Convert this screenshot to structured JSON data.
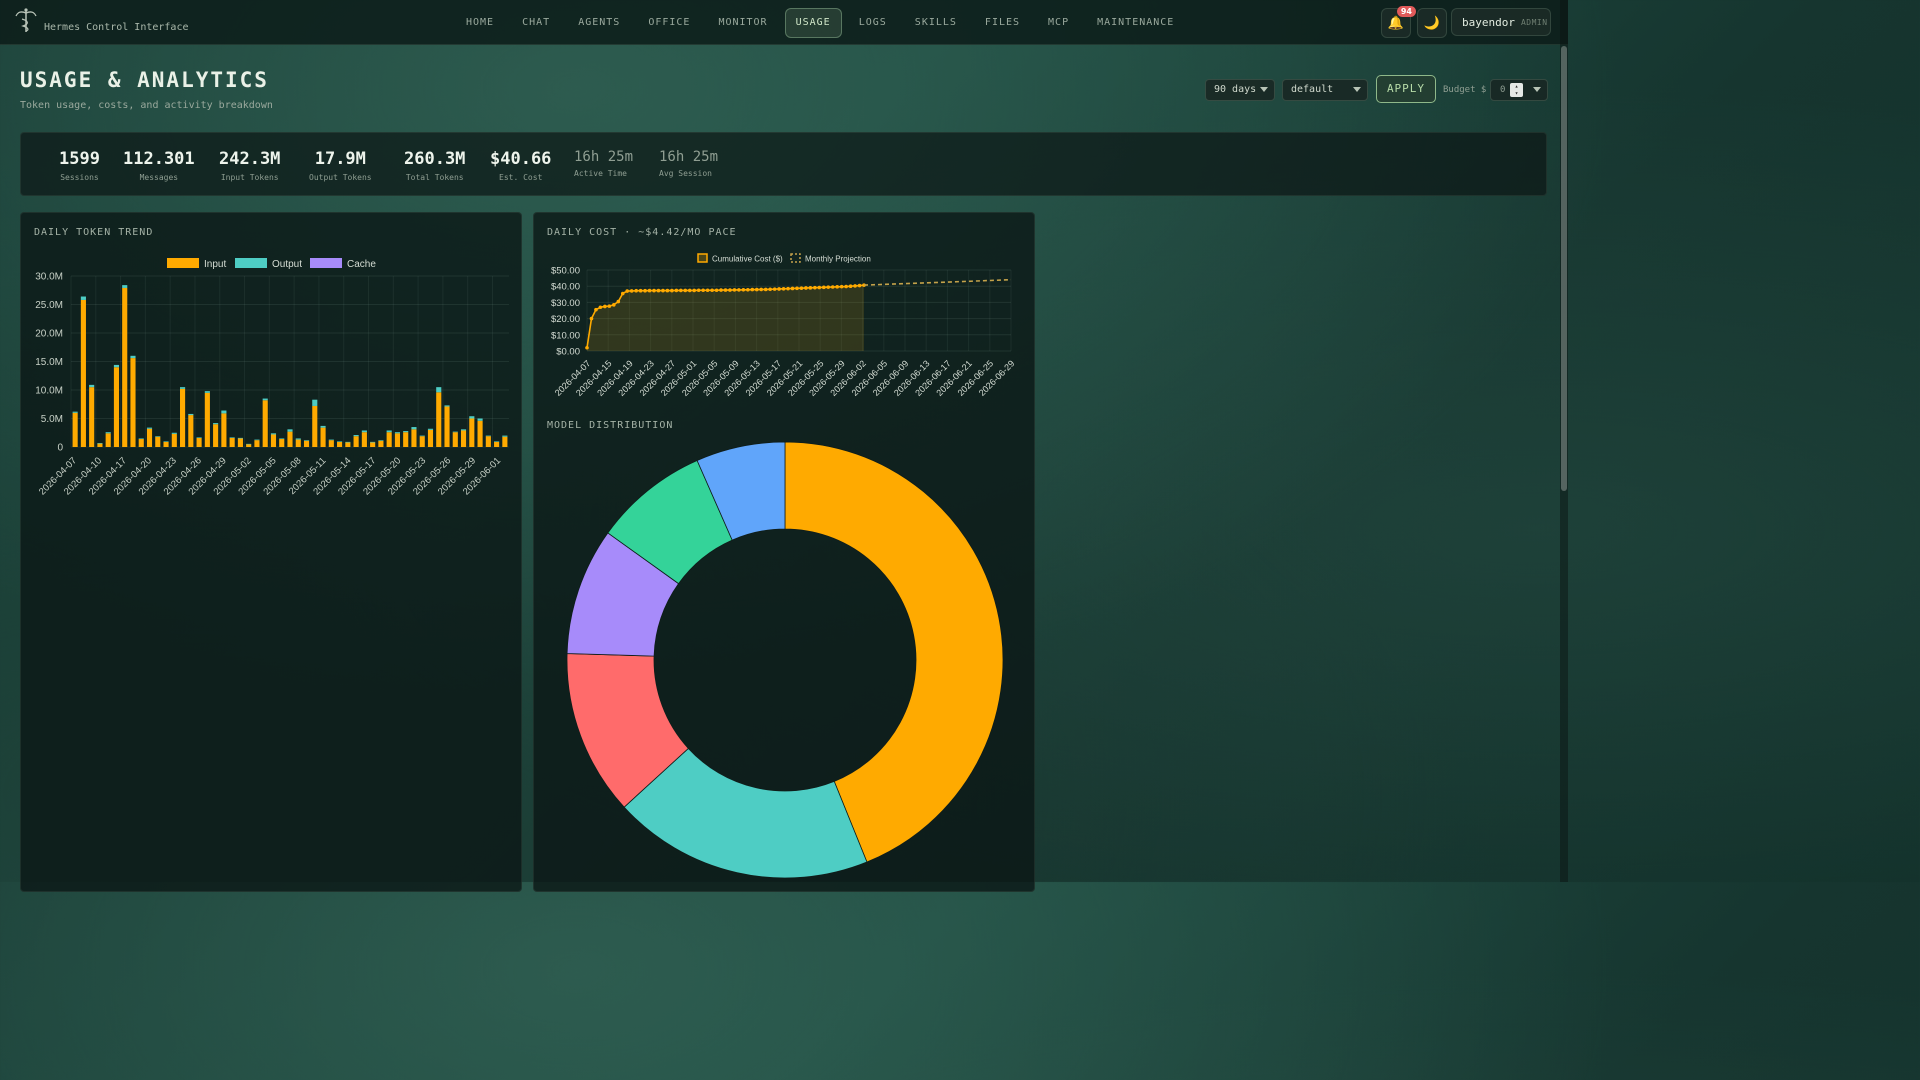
{
  "app": {
    "title": "Hermes Control Interface"
  },
  "nav": {
    "items": [
      "HOME",
      "CHAT",
      "AGENTS",
      "OFFICE",
      "MONITOR",
      "USAGE",
      "LOGS",
      "SKILLS",
      "FILES",
      "MCP",
      "MAINTENANCE"
    ],
    "active": "USAGE"
  },
  "notifications": {
    "count": "94"
  },
  "user": {
    "name": "bayendor",
    "role": "ADMIN"
  },
  "header": {
    "title": "USAGE & ANALYTICS",
    "subtitle": "Token usage, costs, and activity breakdown"
  },
  "controls": {
    "range": "90 days",
    "profile": "default",
    "apply_label": "APPLY",
    "budget_label": "Budget $",
    "budget_value": "0"
  },
  "stats": [
    {
      "value": "1599",
      "label": "Sessions"
    },
    {
      "value": "112.301",
      "label": "Messages"
    },
    {
      "value": "242.3M",
      "label": "Input Tokens"
    },
    {
      "value": "17.9M",
      "label": "Output Tokens"
    },
    {
      "value": "260.3M",
      "label": "Total Tokens"
    },
    {
      "value": "$40.66",
      "label": "Est. Cost"
    },
    {
      "value": "16h 25m",
      "label": "Active Time"
    },
    {
      "value": "16h 25m",
      "label": "Avg Session"
    }
  ],
  "panels": {
    "token_trend_title": "DAILY TOKEN TREND",
    "daily_cost_title": "DAILY COST · ~$4.42/MO PACE",
    "model_distribution_title": "MODEL DISTRIBUTION"
  },
  "colors": {
    "input": "#ffaa00",
    "output": "#4ecdc4",
    "cache": "#a78bfa",
    "accent": "#8fb88a",
    "badge": "#e05a5a"
  },
  "icons": {
    "logo": "caduceus-icon",
    "notification": "bell-icon",
    "theme": "moon-icon"
  },
  "chart_data": [
    {
      "type": "bar",
      "title": "",
      "stacked": true,
      "legend": "top",
      "legend_entries": [
        "Input",
        "Output",
        "Cache"
      ],
      "ylim": [
        0,
        30000000
      ],
      "ytick_labels": [
        "0",
        "5.0M",
        "10.0M",
        "15.0M",
        "20.0M",
        "25.0M",
        "30.0M"
      ],
      "xtick_labels": [
        "2026-04-07",
        "2026-04-10",
        "2026-04-17",
        "2026-04-20",
        "2026-04-23",
        "2026-04-26",
        "2026-04-29",
        "2026-05-02",
        "2026-05-05",
        "2026-05-08",
        "2026-05-11",
        "2026-05-14",
        "2026-05-17",
        "2026-05-20",
        "2026-05-23",
        "2026-05-26",
        "2026-05-29",
        "2026-06-01"
      ],
      "series": [
        {
          "name": "Input",
          "values": [
            6.0,
            25.8,
            10.5,
            0.6,
            2.4,
            14.0,
            27.9,
            15.6,
            1.4,
            3.2,
            1.8,
            0.9,
            2.3,
            10.2,
            5.6,
            1.6,
            9.5,
            4.0,
            5.9,
            1.6,
            1.5,
            0.5,
            1.2,
            8.2,
            2.2,
            1.4,
            2.7,
            1.3,
            1.1,
            7.2,
            3.4,
            1.2,
            0.9,
            0.8,
            1.9,
            2.6,
            0.8,
            1.1,
            2.6,
            2.4,
            2.6,
            3.1,
            1.9,
            3.0,
            9.6,
            7.1,
            2.6,
            2.9,
            5.0,
            4.6,
            1.9,
            0.9,
            1.8
          ]
        },
        {
          "name": "Output",
          "values": [
            0.2,
            0.6,
            0.4,
            0.1,
            0.2,
            0.4,
            0.5,
            0.4,
            0.1,
            0.2,
            0.1,
            0.1,
            0.2,
            0.3,
            0.2,
            0.1,
            0.3,
            0.2,
            0.5,
            0.1,
            0.1,
            0.05,
            0.1,
            0.3,
            0.2,
            0.1,
            0.4,
            0.2,
            0.1,
            1.1,
            0.3,
            0.1,
            0.1,
            0.1,
            0.2,
            0.3,
            0.1,
            0.1,
            0.3,
            0.2,
            0.2,
            0.4,
            0.1,
            0.2,
            0.9,
            0.2,
            0.1,
            0.2,
            0.4,
            0.4,
            0.1,
            0.1,
            0.2
          ]
        },
        {
          "name": "Cache",
          "values": []
        }
      ]
    },
    {
      "type": "line",
      "title": "",
      "legend": "top",
      "ylim": [
        0,
        50
      ],
      "ytick_labels": [
        "$0.00",
        "$10.00",
        "$20.00",
        "$30.00",
        "$40.00",
        "$50.00"
      ],
      "xtick_labels": [
        "2026-04-07",
        "2026-04-15",
        "2026-04-19",
        "2026-04-23",
        "2026-04-27",
        "2026-05-01",
        "2026-05-05",
        "2026-05-09",
        "2026-05-13",
        "2026-05-17",
        "2026-05-21",
        "2026-05-25",
        "2026-05-29",
        "2026-06-02",
        "2026-06-05",
        "2026-06-09",
        "2026-06-13",
        "2026-06-17",
        "2026-06-21",
        "2026-06-25",
        "2026-06-29"
      ],
      "series": [
        {
          "name": "Cumulative Cost ($)",
          "values": [
            2.0,
            20.0,
            25.5,
            27.0,
            27.5,
            27.7,
            28.5,
            30.5,
            35.5,
            37.0,
            37.1,
            37.2,
            37.2,
            37.2,
            37.3,
            37.3,
            37.3,
            37.3,
            37.3,
            37.3,
            37.4,
            37.4,
            37.4,
            37.4,
            37.4,
            37.5,
            37.5,
            37.5,
            37.5,
            37.5,
            37.6,
            37.6,
            37.6,
            37.7,
            37.7,
            37.8,
            37.8,
            37.9,
            37.9,
            38.0,
            38.0,
            38.1,
            38.2,
            38.3,
            38.4,
            38.5,
            38.6,
            38.7,
            38.8,
            38.9,
            39.0,
            39.1,
            39.2,
            39.3,
            39.4,
            39.5,
            39.6,
            39.7,
            39.8,
            40.0,
            40.2,
            40.4,
            40.66
          ]
        },
        {
          "name": "Monthly Projection",
          "values": [
            40.66,
            44.0
          ]
        }
      ]
    },
    {
      "type": "pie",
      "title": "",
      "donut": true,
      "values": [
        46.5,
        20.5,
        13.0,
        10.0,
        9.0,
        7.0
      ],
      "colors": [
        "#ffaa00",
        "#4ecdc4",
        "#ff6b6b",
        "#a78bfa",
        "#34d399",
        "#60a5fa"
      ]
    }
  ]
}
